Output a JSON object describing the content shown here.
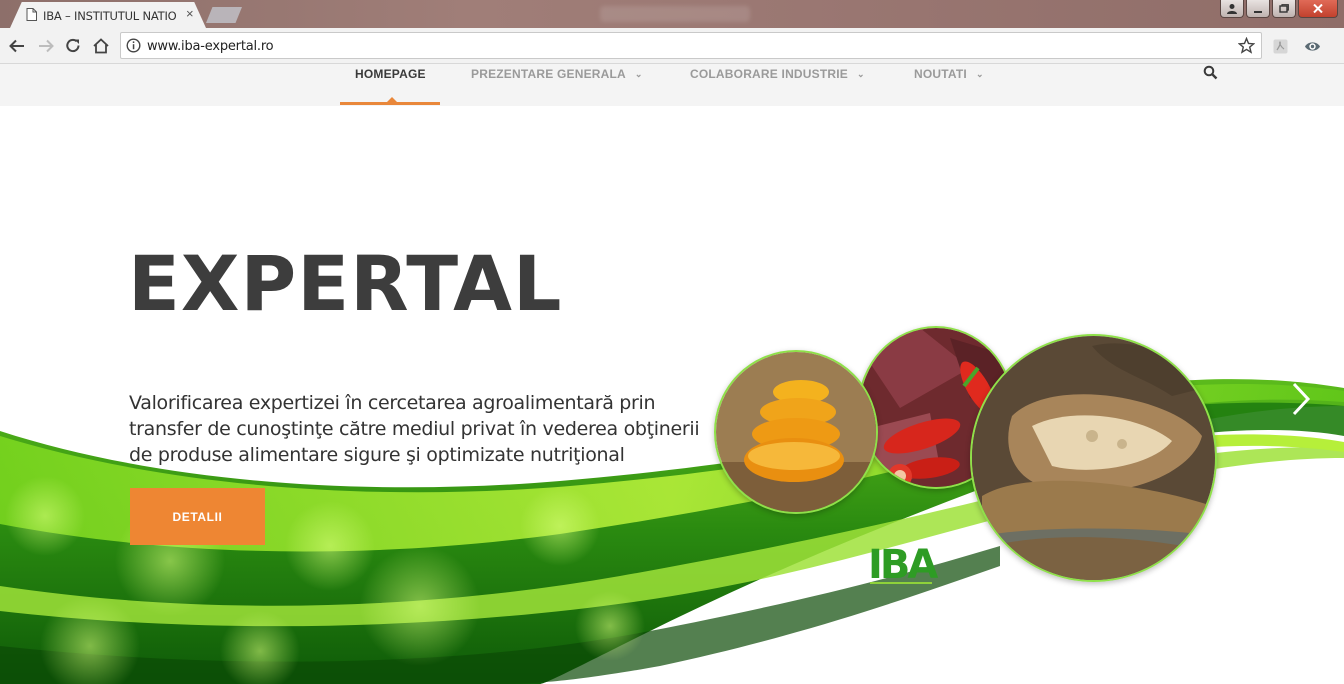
{
  "browser": {
    "tab_title": "IBA – INSTITUTUL NATIO",
    "tab_close": "×",
    "url": "www.iba-expertal.ro"
  },
  "nav": {
    "items": [
      {
        "label": "HOMEPAGE",
        "active": true
      },
      {
        "label": "PREZENTARE GENERALA",
        "active": false,
        "dropdown": true
      },
      {
        "label": "COLABORARE INDUSTRIE",
        "active": false,
        "dropdown": true
      },
      {
        "label": "NOUTATI",
        "active": false,
        "dropdown": true
      }
    ],
    "chevron": "⌄",
    "search_icon": "search-icon"
  },
  "hero": {
    "title": "EXPERTAL",
    "text": "Valorificarea expertizei în cercetarea agroalimentară prin transfer de cunoştinţe către mediul privat în vederea obţinerii de produse alimentare sigure şi optimizate nutriţional",
    "cta_label": "DETALII",
    "logo_text": "IBA"
  },
  "colors": {
    "accent": "#ee8633",
    "title": "#3d3d3d",
    "green_dark": "#1f7d10",
    "green_light": "#9fe23a"
  }
}
